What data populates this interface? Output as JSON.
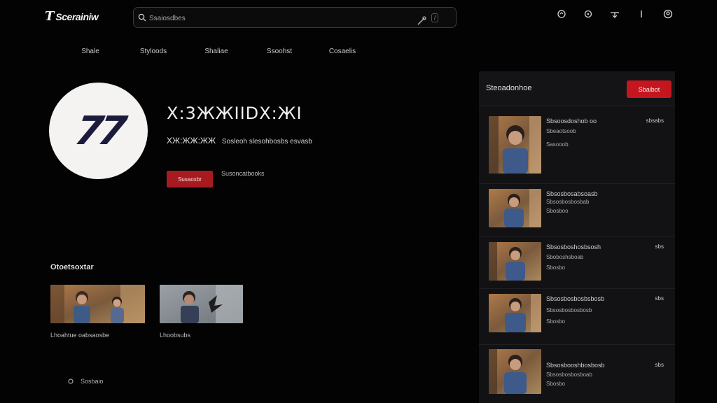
{
  "header": {
    "logo_mark": "T",
    "logo_text": "Scerainiw",
    "search": {
      "value": "",
      "placeholder": "Ssaiosdbes",
      "shortcut": "/"
    },
    "icons": [
      "cast-icon",
      "notifications-icon",
      "upload-icon",
      "menu-icon",
      "account-icon"
    ]
  },
  "nav": {
    "items": [
      "Shale",
      "Styloods",
      "Shaliae",
      "Ssoohst",
      "Cosaelis"
    ]
  },
  "channel": {
    "avatar_text": "77",
    "name": "X:3ЖЖIIDX:ЖI",
    "handle": "XЖ:ЖЖ:ЖЖ",
    "meta": "Sosleoh slesohbosbs esvasb",
    "primary_button": "Susaoxbr",
    "secondary_link": "Susoncatbooks"
  },
  "shelf": {
    "title": "Otoetsoxtar",
    "cards": [
      {
        "caption": "Lhoahtue oabsaosbe"
      },
      {
        "caption": "Lhoobsubs"
      }
    ]
  },
  "footer": {
    "link": "Sosbaio"
  },
  "panel": {
    "title": "Steoadonhoe",
    "button": "Sbaibot",
    "items": [
      {
        "title": "Sbsoosdoshob oo",
        "sub": "Sbeaotsoob",
        "sub2": "Sasooob",
        "duration": "sbsabs"
      },
      {
        "title": "Sbsosbosabsoasb",
        "sub": "Sbsosbosbosbab",
        "sub2": "Sbosboo",
        "duration": ""
      },
      {
        "title": "Sbsosboshosbsosh",
        "sub": "Sboboshsboab",
        "sub2": "Sbosbo",
        "duration": "sbs"
      },
      {
        "title": "Sbsosbosbosbsbosb",
        "sub": "Sbsosbosbosbosb",
        "sub2": "Sbosbo",
        "duration": "sbs"
      },
      {
        "title": "Sbsosbooshbosbosb",
        "sub": "Sbsosbosbosboab",
        "sub2": "Sbosbo",
        "duration": "sbs"
      }
    ]
  },
  "colors": {
    "background": "#030303",
    "panel": "#121214",
    "accent_red": "#c5161f",
    "button_red": "#a71b20",
    "avatar_bg": "#f4f3f1",
    "avatar_fg": "#1c1b3c"
  }
}
